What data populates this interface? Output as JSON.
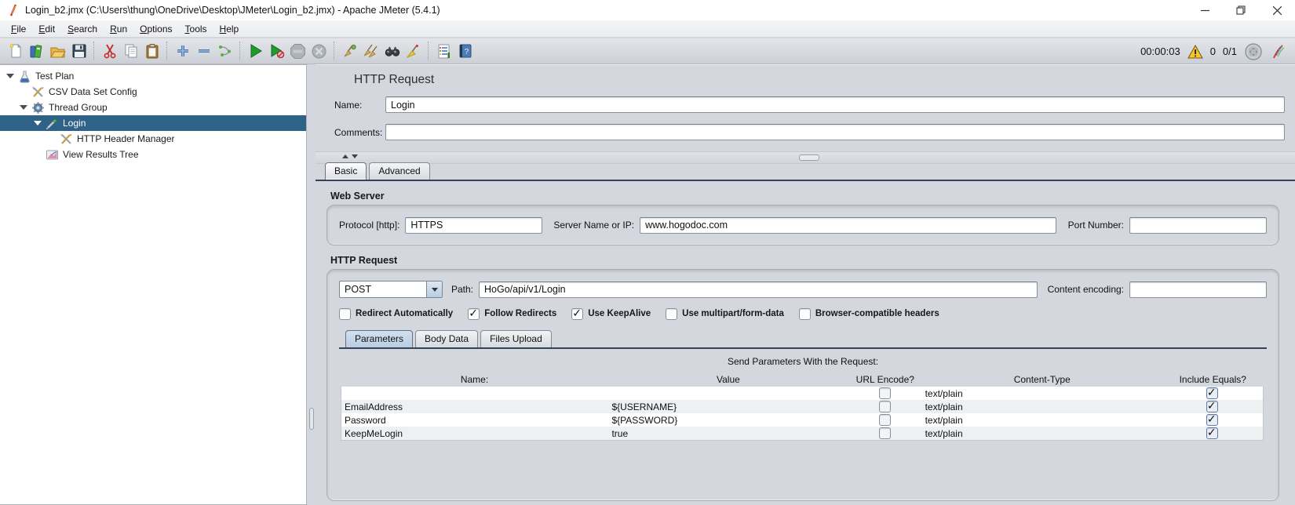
{
  "window": {
    "title": "Login_b2.jmx (C:\\Users\\thung\\OneDrive\\Desktop\\JMeter\\Login_b2.jmx) - Apache JMeter (5.4.1)",
    "controls": {
      "minimize": "minimize",
      "restore": "restore",
      "close": "close"
    }
  },
  "menu": {
    "items": [
      {
        "label": "File"
      },
      {
        "label": "Edit"
      },
      {
        "label": "Search"
      },
      {
        "label": "Run"
      },
      {
        "label": "Options"
      },
      {
        "label": "Tools"
      },
      {
        "label": "Help"
      }
    ]
  },
  "toolbar": {
    "icons": [
      "new-file-icon",
      "templates-icon",
      "open-file-icon",
      "save-icon",
      "cut-icon",
      "copy-icon",
      "paste-icon",
      "expand-all-icon",
      "collapse-all-icon",
      "toggle-icon",
      "start-icon",
      "start-no-pauses-icon",
      "stop-icon",
      "shutdown-icon",
      "clear-icon",
      "clear-all-icon",
      "search-icon",
      "search-reset-icon",
      "function-helper-icon",
      "help-icon"
    ],
    "status": {
      "elapsed": "00:00:03",
      "error_count": "0",
      "thread_count": "0/1"
    },
    "status_icons": [
      "warning-icon",
      "threads-state-icon",
      "jmeter-logo-icon"
    ]
  },
  "tree": {
    "items": [
      {
        "label": "Test Plan",
        "icon": "test-plan-icon"
      },
      {
        "label": "CSV Data Set Config",
        "icon": "config-element-icon"
      },
      {
        "label": "Thread Group",
        "icon": "thread-group-icon"
      },
      {
        "label": "Login",
        "icon": "sampler-icon",
        "selected": true
      },
      {
        "label": "HTTP Header Manager",
        "icon": "config-element-icon"
      },
      {
        "label": "View Results Tree",
        "icon": "listener-icon"
      }
    ]
  },
  "editor": {
    "title": "HTTP Request",
    "name": {
      "label": "Name:",
      "value": "Login"
    },
    "comments": {
      "label": "Comments:",
      "value": ""
    },
    "tabs": [
      {
        "label": "Basic",
        "selected": true
      },
      {
        "label": "Advanced",
        "selected": false
      }
    ],
    "web_server": {
      "section": "Web Server",
      "protocol_label": "Protocol [http]:",
      "protocol_value": "HTTPS",
      "server_label": "Server Name or IP:",
      "server_value": "www.hogodoc.com",
      "port_label": "Port Number:",
      "port_value": ""
    },
    "http_request": {
      "section": "HTTP Request",
      "method_value": "POST",
      "path_label": "Path:",
      "path_value": "HoGo/api/v1/Login",
      "encoding_label": "Content encoding:",
      "encoding_value": ""
    },
    "options": [
      {
        "label": "Redirect Automatically",
        "checked": false
      },
      {
        "label": "Follow Redirects",
        "checked": true
      },
      {
        "label": "Use KeepAlive",
        "checked": true
      },
      {
        "label": "Use multipart/form-data",
        "checked": false
      },
      {
        "label": "Browser-compatible headers",
        "checked": false
      }
    ],
    "param_tabs": [
      {
        "label": "Parameters",
        "selected": true
      },
      {
        "label": "Body Data",
        "selected": false
      },
      {
        "label": "Files Upload",
        "selected": false
      }
    ],
    "params": {
      "caption": "Send Parameters With the Request:",
      "headers": [
        "Name:",
        "Value",
        "URL Encode?",
        "Content-Type",
        "Include Equals?"
      ],
      "rows": [
        {
          "name": "",
          "value": "",
          "url_encode": false,
          "content_type": "text/plain",
          "include_equals": true
        },
        {
          "name": "EmailAddress",
          "value": "${USERNAME}",
          "url_encode": false,
          "content_type": "text/plain",
          "include_equals": true
        },
        {
          "name": "Password",
          "value": "${PASSWORD}",
          "url_encode": false,
          "content_type": "text/plain",
          "include_equals": true
        },
        {
          "name": "KeepMeLogin",
          "value": "true",
          "url_encode": false,
          "content_type": "text/plain",
          "include_equals": true
        }
      ]
    }
  },
  "colors": {
    "selection": "#2e6286",
    "panel": "#d4d7dd",
    "tab_underline": "#35435a",
    "warning": "#f5c231",
    "start_green": "#1f9a2e",
    "accent_blue": "#4d7bb5"
  }
}
